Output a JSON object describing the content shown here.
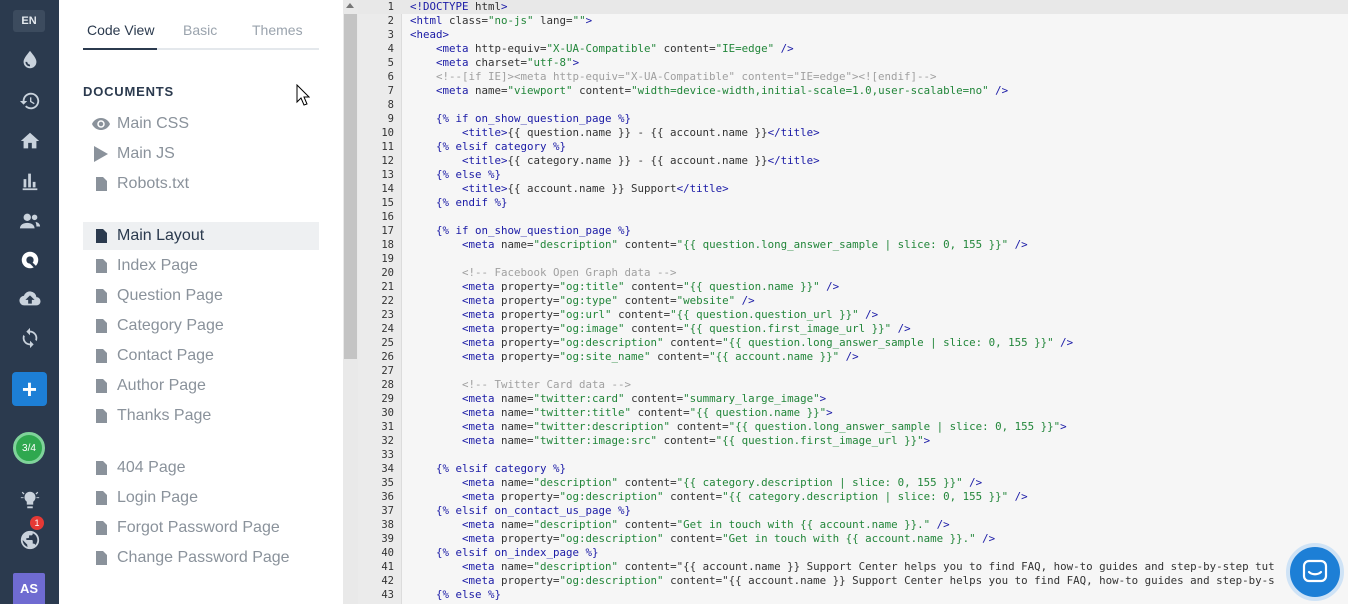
{
  "rail": {
    "language": "EN",
    "progress": "3/4",
    "notification_count": "1",
    "avatar_initials": "AS",
    "icons": [
      "droplet-icon",
      "history-icon",
      "home-icon",
      "bar-chart-icon",
      "users-icon",
      "support-icon",
      "cloud-upload-icon",
      "sync-icon",
      "add-icon",
      "progress-icon",
      "lightbulb-icon",
      "globe-icon"
    ]
  },
  "tabs": [
    "Code View",
    "Basic",
    "Themes"
  ],
  "documents": {
    "heading": "DOCUMENTS",
    "assets": [
      {
        "label": "Main CSS",
        "icon": "eye-icon"
      },
      {
        "label": "Main JS",
        "icon": "play-icon"
      },
      {
        "label": "Robots.txt",
        "icon": "file-icon"
      }
    ],
    "pages": [
      {
        "label": "Main Layout",
        "active": true
      },
      {
        "label": "Index Page"
      },
      {
        "label": "Question Page"
      },
      {
        "label": "Category Page"
      },
      {
        "label": "Contact Page"
      },
      {
        "label": "Author Page"
      },
      {
        "label": "Thanks Page"
      }
    ],
    "system_pages": [
      {
        "label": "404 Page"
      },
      {
        "label": "Login Page"
      },
      {
        "label": "Forgot Password Page"
      },
      {
        "label": "Change Password Page"
      }
    ]
  },
  "editor": {
    "lines": [
      "<!DOCTYPE html>",
      "<html class=\"no-js\" lang=\"\">",
      "<head>",
      "    <meta http-equiv=\"X-UA-Compatible\" content=\"IE=edge\" />",
      "    <meta charset=\"utf-8\">",
      "    <!--[if IE]><meta http-equiv=\"X-UA-Compatible\" content=\"IE=edge\"><![endif]-->",
      "    <meta name=\"viewport\" content=\"width=device-width,initial-scale=1.0,user-scalable=no\" />",
      "",
      "    {% if on_show_question_page %}",
      "        <title>{{ question.name }} - {{ account.name }}</title>",
      "    {% elsif category %}",
      "        <title>{{ category.name }} - {{ account.name }}</title>",
      "    {% else %}",
      "        <title>{{ account.name }} Support</title>",
      "    {% endif %}",
      "",
      "    {% if on_show_question_page %}",
      "        <meta name=\"description\" content=\"{{ question.long_answer_sample | slice: 0, 155 }}\" />",
      "",
      "        <!-- Facebook Open Graph data -->",
      "        <meta property=\"og:title\" content=\"{{ question.name }}\" />",
      "        <meta property=\"og:type\" content=\"website\" />",
      "        <meta property=\"og:url\" content=\"{{ question.question_url }}\" />",
      "        <meta property=\"og:image\" content=\"{{ question.first_image_url }}\" />",
      "        <meta property=\"og:description\" content=\"{{ question.long_answer_sample | slice: 0, 155 }}\" />",
      "        <meta property=\"og:site_name\" content=\"{{ account.name }}\" />",
      "",
      "        <!-- Twitter Card data -->",
      "        <meta name=\"twitter:card\" content=\"summary_large_image\">",
      "        <meta name=\"twitter:title\" content=\"{{ question.name }}\">",
      "        <meta name=\"twitter:description\" content=\"{{ question.long_answer_sample | slice: 0, 155 }}\">",
      "        <meta name=\"twitter:image:src\" content=\"{{ question.first_image_url }}\">",
      "",
      "    {% elsif category %}",
      "        <meta name=\"description\" content=\"{{ category.description | slice: 0, 155 }}\" />",
      "        <meta property=\"og:description\" content=\"{{ category.description | slice: 0, 155 }}\" />",
      "    {% elsif on_contact_us_page %}",
      "        <meta name=\"description\" content=\"Get in touch with {{ account.name }}.\" />",
      "        <meta property=\"og:description\" content=\"Get in touch with {{ account.name }}.\" />",
      "    {% elsif on_index_page %}",
      "        <meta name=\"description\" content=\"{{ account.name }} Support Center helps you to find FAQ, how-to guides and step-by-step tut",
      "        <meta property=\"og:description\" content=\"{{ account.name }} Support Center helps you to find FAQ, how-to guides and step-by-s",
      "    {% else %}"
    ]
  },
  "colors": {
    "rail_bg": "#2b3a4e",
    "accent": "#1d7fd6",
    "progress": "#2fa84f",
    "badge": "#e53935",
    "avatar": "#6f6bd1"
  }
}
